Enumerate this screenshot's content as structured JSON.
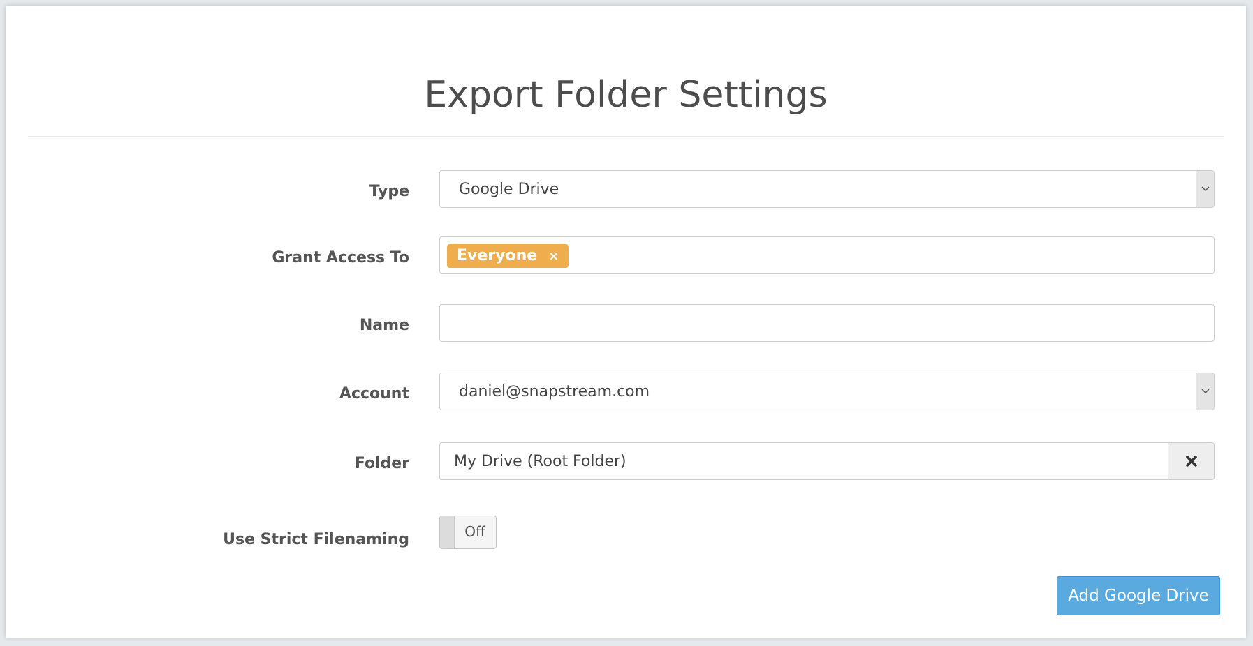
{
  "dialog": {
    "title": "Export Folder Settings"
  },
  "form": {
    "type": {
      "label": "Type",
      "value": "Google Drive"
    },
    "grant_access": {
      "label": "Grant Access To",
      "tags": [
        {
          "label": "Everyone",
          "remove_glyph": "×"
        }
      ]
    },
    "name": {
      "label": "Name",
      "value": ""
    },
    "account": {
      "label": "Account",
      "value": "daniel@snapstream.com"
    },
    "folder": {
      "label": "Folder",
      "value": "My Drive (Root Folder)",
      "clear_icon": "close-icon"
    },
    "strict_filenaming": {
      "label": "Use Strict Filenaming",
      "state_text": "Off",
      "enabled": false
    }
  },
  "actions": {
    "submit_label": "Add Google Drive"
  },
  "colors": {
    "tag": "#f0ad4e",
    "primary": "#5aaae0"
  }
}
